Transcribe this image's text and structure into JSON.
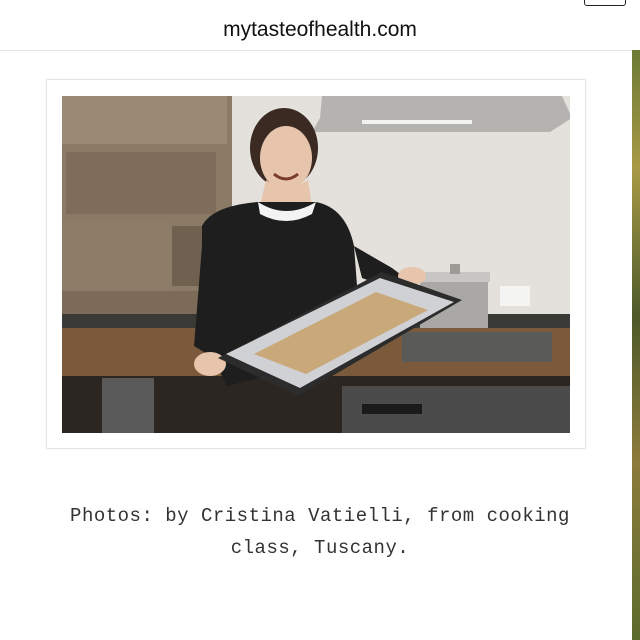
{
  "browser": {
    "url": "mytasteofhealth.com"
  },
  "photo": {
    "icon": "photo-woman-holding-baking-tray"
  },
  "caption": {
    "line1": "Photos: by Cristina Vatielli, from cooking",
    "line2": "class, Tuscany."
  },
  "colors": {
    "background": "#ffffff",
    "text": "#333333"
  }
}
